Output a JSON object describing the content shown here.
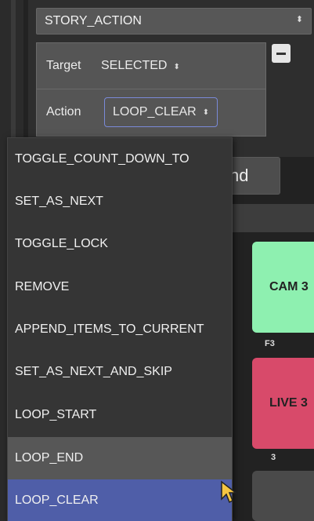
{
  "story_select": {
    "value": "STORY_ACTION",
    "arrows": "⬍"
  },
  "params": {
    "target_label": "Target",
    "target_value": "SELECTED",
    "action_label": "Action",
    "action_value": "LOOP_CLEAR",
    "arrows": "⬍"
  },
  "partial_button_label": "nd",
  "dropdown": {
    "items": [
      "TOGGLE_COUNT_DOWN_TO",
      "SET_AS_NEXT",
      "TOGGLE_LOCK",
      "REMOVE",
      "APPEND_ITEMS_TO_CURRENT",
      "SET_AS_NEXT_AND_SKIP",
      "LOOP_START",
      "LOOP_END",
      "LOOP_CLEAR"
    ],
    "hovered": "LOOP_END",
    "selected": "LOOP_CLEAR"
  },
  "tiles": {
    "cam_label": "CAM 3",
    "cam_hotkey": "F3",
    "live_label": "LIVE 3",
    "live_hotkey": "3"
  },
  "colors": {
    "selected": "#4f5ea8",
    "cam_tile": "#8ef0b0",
    "live_tile": "#d84a6a",
    "cursor": "#f5c542"
  }
}
